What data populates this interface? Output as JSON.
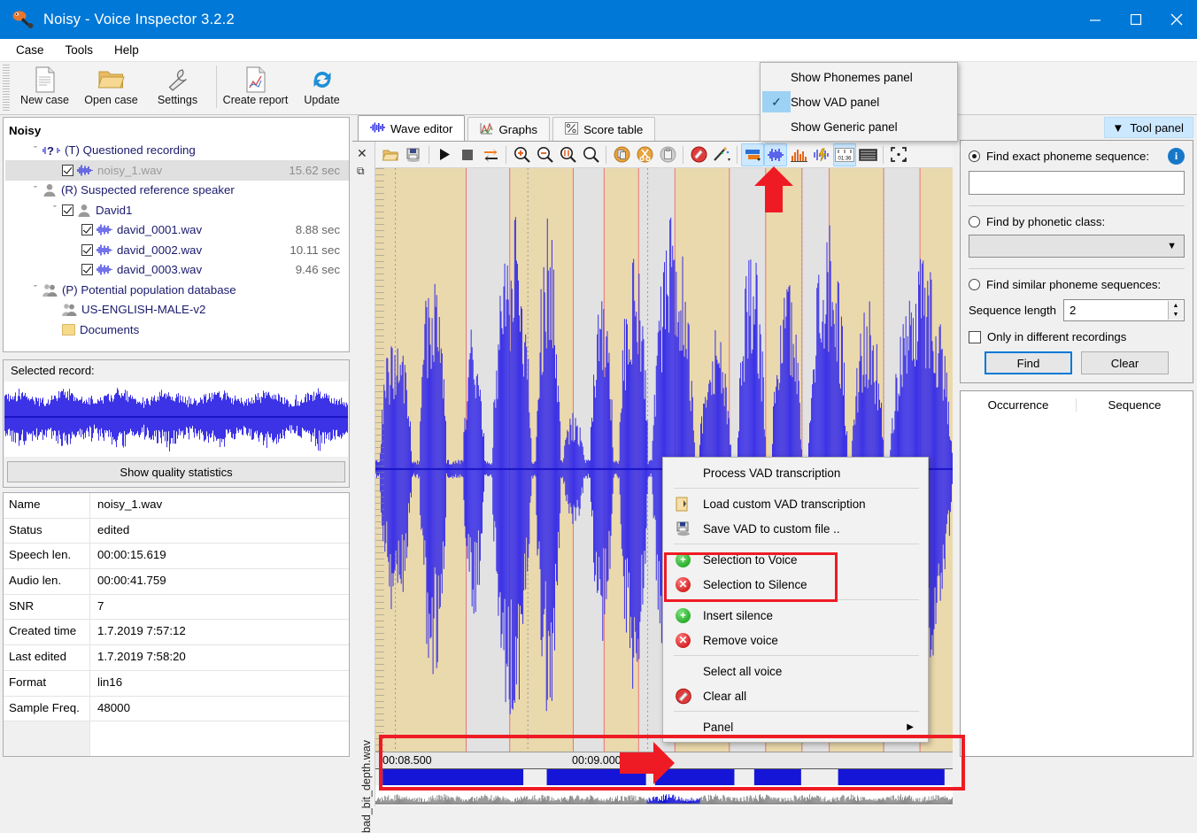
{
  "window": {
    "title": "Noisy - Voice Inspector 3.2.2",
    "app_icon": "speaker-icon",
    "minimize": "—",
    "maximize": "☐",
    "close": "✕",
    "accent_color": "#0078d7"
  },
  "menubar": {
    "items": [
      "Case",
      "Tools",
      "Help"
    ]
  },
  "toolbar": {
    "buttons": [
      {
        "label": "New case",
        "icon": "new-document-icon"
      },
      {
        "label": "Open case",
        "icon": "open-folder-icon"
      },
      {
        "label": "Settings",
        "icon": "wrench-icon"
      },
      {
        "label": "Create report",
        "icon": "report-document-icon"
      },
      {
        "label": "Update",
        "icon": "refresh-icon"
      }
    ]
  },
  "tree": {
    "root": "Noisy",
    "nodes": [
      {
        "label": "(T) Questioned recording",
        "icon": "question-wave-icon",
        "indent": 1,
        "expander": "ˇ",
        "checkbox": false,
        "duration": ""
      },
      {
        "label": "noisy_1.wav",
        "icon": "wave-icon",
        "indent": 2,
        "expander": "",
        "checkbox": true,
        "duration": "15.62 sec",
        "selected": true,
        "dim": true
      },
      {
        "label": "(R) Suspected reference speaker",
        "icon": "person-icon",
        "indent": 1,
        "expander": "ˇ",
        "checkbox": false,
        "duration": ""
      },
      {
        "label": "David1",
        "icon": "person-icon",
        "indent": 2,
        "expander": "ˇ",
        "checkbox": true,
        "duration": ""
      },
      {
        "label": "david_0001.wav",
        "icon": "wave-icon",
        "indent": 3,
        "expander": "",
        "checkbox": true,
        "duration": "8.88 sec"
      },
      {
        "label": "david_0002.wav",
        "icon": "wave-icon",
        "indent": 3,
        "expander": "",
        "checkbox": true,
        "duration": "10.11 sec"
      },
      {
        "label": "david_0003.wav",
        "icon": "wave-icon",
        "indent": 3,
        "expander": "",
        "checkbox": true,
        "duration": "9.46 sec"
      },
      {
        "label": "(P) Potential population database",
        "icon": "people-icon",
        "indent": 1,
        "expander": "ˇ",
        "checkbox": false,
        "duration": ""
      },
      {
        "label": "US-ENGLISH-MALE-v2",
        "icon": "people-icon",
        "indent": 2,
        "expander": "",
        "checkbox": false,
        "duration": ""
      },
      {
        "label": "Documents",
        "icon": "folder-icon",
        "indent": 2,
        "expander": "",
        "checkbox": false,
        "duration": ""
      }
    ]
  },
  "selected_record": {
    "title": "Selected record:",
    "quality_button": "Show quality statistics"
  },
  "properties": {
    "rows": [
      {
        "key": "Name",
        "value": "noisy_1.wav"
      },
      {
        "key": "Status",
        "value": "edited"
      },
      {
        "key": "Speech len.",
        "value": "00:00:15.619"
      },
      {
        "key": "Audio len.",
        "value": "00:00:41.759"
      },
      {
        "key": "SNR",
        "value": "7"
      },
      {
        "key": "Created time",
        "value": "1.7.2019 7:57:12"
      },
      {
        "key": "Last edited",
        "value": "1.7.2019 7:58:20"
      },
      {
        "key": "Format",
        "value": "lin16"
      },
      {
        "key": "Sample Freq.",
        "value": "48000"
      }
    ]
  },
  "tabs": [
    {
      "label": "Wave editor",
      "icon": "wave-icon",
      "active": true
    },
    {
      "label": "Graphs",
      "icon": "graph-icon",
      "active": false
    },
    {
      "label": "Score table",
      "icon": "percent-table-icon",
      "active": false
    }
  ],
  "editor": {
    "close_icon": "close-icon",
    "restore_icon": "restore-icon",
    "file_label": "bad_bit_depth.wav",
    "toolbar_icons": [
      "open-folder-icon",
      "save-icon",
      "play-icon",
      "stop-icon",
      "loop-icon",
      "zoom-in-icon",
      "zoom-out-icon",
      "zoom-selection-icon",
      "zoom-fit-icon",
      "copy-icon",
      "cut-icon",
      "paste-icon",
      "delete-icon",
      "magic-wand-icon",
      "vad-panel-icon",
      "waveform-icon",
      "spectrum-icon",
      "energy-icon",
      "timeline-icon",
      "spectrogram-icon",
      "fullscreen-icon"
    ],
    "active_toolbar_icons": [
      "vad-panel-icon",
      "waveform-icon",
      "timeline-icon"
    ]
  },
  "timeline": {
    "ticks": [
      "00:08.500",
      "00:09.000"
    ]
  },
  "panel_menu": {
    "items": [
      {
        "label": "Show Phonemes panel",
        "checked": false
      },
      {
        "label": "Show VAD panel",
        "checked": true
      },
      {
        "label": "Show Generic panel",
        "checked": false
      }
    ],
    "check_glyph": "✓"
  },
  "context_menu": {
    "groups": [
      [
        {
          "label": "Process VAD transcription",
          "icon": ""
        }
      ],
      [
        {
          "label": "Load custom VAD transcription",
          "icon": "load-file-icon"
        },
        {
          "label": "Save VAD to custom file ..",
          "icon": "save-file-icon"
        }
      ],
      [
        {
          "label": "Selection to Voice",
          "icon": "plus-green-icon",
          "highlighted": true
        },
        {
          "label": "Selection to Silence",
          "icon": "cross-red-icon",
          "highlighted": true
        }
      ],
      [
        {
          "label": "Insert silence",
          "icon": "plus-green-icon"
        },
        {
          "label": "Remove voice",
          "icon": "cross-red-icon"
        }
      ],
      [
        {
          "label": "Select all voice",
          "icon": ""
        },
        {
          "label": "Clear all",
          "icon": "clear-stamp-icon"
        }
      ],
      [
        {
          "label": "Panel",
          "icon": "",
          "submenu": true
        }
      ]
    ],
    "submenu_arrow": "▶"
  },
  "tool_panel": {
    "header": {
      "label": "Tool panel",
      "chevron": "▼"
    },
    "find_exact": {
      "label": "Find exact phoneme sequence:",
      "selected": true,
      "value": "",
      "info_icon": "info-icon",
      "info_glyph": "i"
    },
    "find_phonetic": {
      "label": "Find by phonetic class:",
      "selected": false,
      "value": "",
      "chevron": "▼"
    },
    "find_similar": {
      "label": "Find similar phoneme sequences:",
      "selected": false
    },
    "sequence_length": {
      "label": "Sequence length",
      "value": "2",
      "up": "▲",
      "down": "▼"
    },
    "only_different": {
      "label": "Only in different recordings",
      "checked": false
    },
    "find_button": "Find",
    "clear_button": "Clear",
    "results": {
      "columns": [
        "Occurrence",
        "Sequence"
      ],
      "rows": []
    }
  },
  "annotations": {
    "arrow_color": "#ee1b24",
    "highlight_color": "#ee1b24",
    "arrow_up": "up-arrow-annotation",
    "arrow_right": "right-arrow-annotation"
  },
  "colors": {
    "waveform": "#3c32e6",
    "voice_region": "#ead9ac",
    "silence_region": "#e2e2e2",
    "marker_line": "#e87878"
  }
}
